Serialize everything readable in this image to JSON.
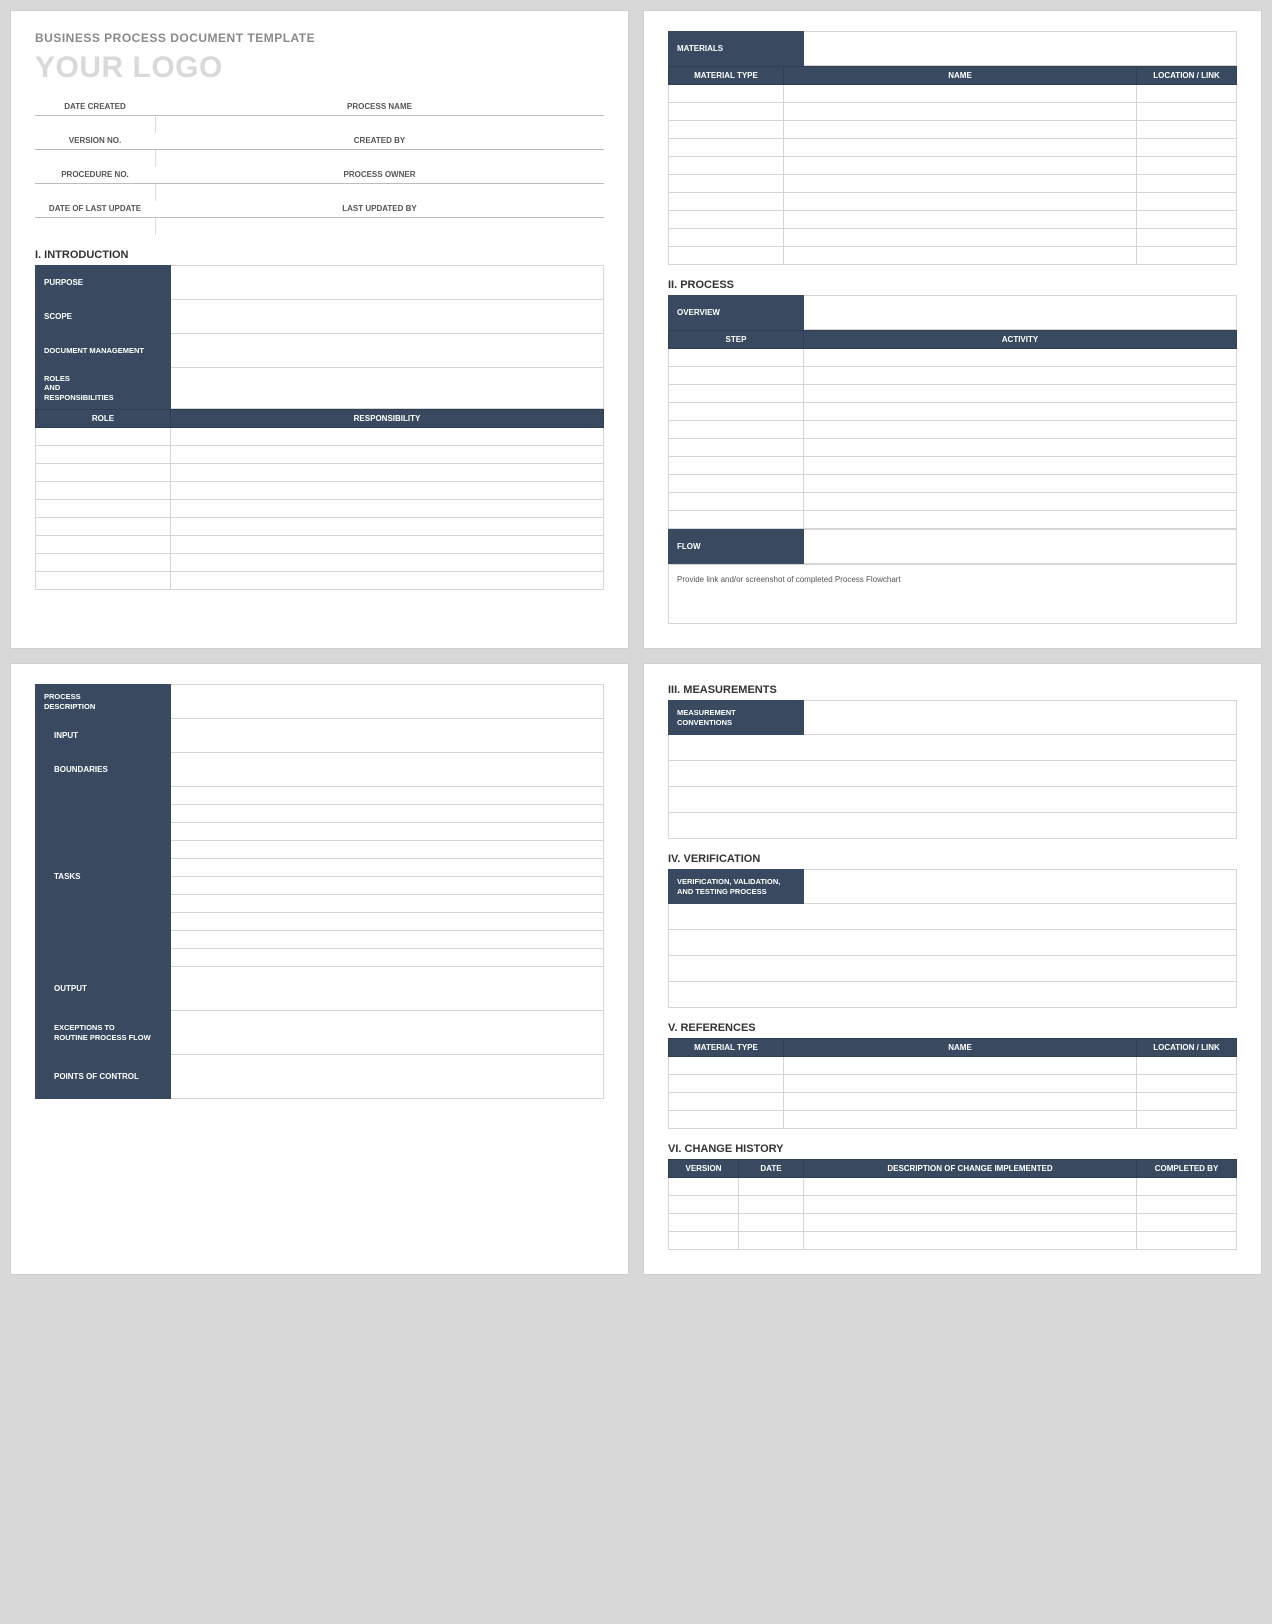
{
  "doc_title": "BUSINESS PROCESS DOCUMENT TEMPLATE",
  "logo_text": "YOUR LOGO",
  "meta": {
    "left": [
      "DATE CREATED",
      "VERSION NO.",
      "PROCEDURE NO.",
      "DATE OF LAST UPDATE"
    ],
    "right": [
      "PROCESS NAME",
      "CREATED BY",
      "PROCESS OWNER",
      "LAST UPDATED BY"
    ]
  },
  "sections": {
    "intro_heading": "I.   INTRODUCTION",
    "intro_labels": {
      "purpose": "PURPOSE",
      "scope": "SCOPE",
      "doc_mgmt": "DOCUMENT MANAGEMENT",
      "roles": "ROLES\nAND\nRESPONSIBILITIES"
    },
    "roles_cols": {
      "role": "ROLE",
      "resp": "RESPONSIBILITY"
    },
    "materials_label": "MATERIALS",
    "materials_cols": {
      "type": "MATERIAL TYPE",
      "name": "NAME",
      "loc": "LOCATION / LINK"
    },
    "process_heading": "II.  PROCESS",
    "overview_label": "OVERVIEW",
    "process_cols": {
      "step": "STEP",
      "activity": "ACTIVITY"
    },
    "flow_label": "FLOW",
    "flow_note": "Provide link and/or screenshot of completed Process Flowchart",
    "proc_desc_label": "PROCESS\nDESCRIPTION",
    "proc_desc_sub": {
      "input": "INPUT",
      "boundaries": "BOUNDARIES",
      "tasks": "TASKS",
      "output": "OUTPUT",
      "exceptions": "EXCEPTIONS TO\nROUTINE PROCESS FLOW",
      "control": "POINTS OF CONTROL"
    },
    "measurements_heading": "III.  MEASUREMENTS",
    "measurement_label": "MEASUREMENT\nCONVENTIONS",
    "verification_heading": "IV.  VERIFICATION",
    "verification_label": "VERIFICATION, VALIDATION,\nAND TESTING PROCESS",
    "references_heading": "V.  REFERENCES",
    "references_cols": {
      "type": "MATERIAL TYPE",
      "name": "NAME",
      "loc": "LOCATION / LINK"
    },
    "change_heading": "VI.  CHANGE HISTORY",
    "change_cols": {
      "ver": "VERSION",
      "date": "DATE",
      "desc": "DESCRIPTION OF CHANGE IMPLEMENTED",
      "by": "COMPLETED BY"
    }
  },
  "row_counts": {
    "roles": 9,
    "materials": 10,
    "process_steps": 10,
    "proc_tasks": 10,
    "measurements": 4,
    "verification": 4,
    "references": 4,
    "change": 4
  }
}
